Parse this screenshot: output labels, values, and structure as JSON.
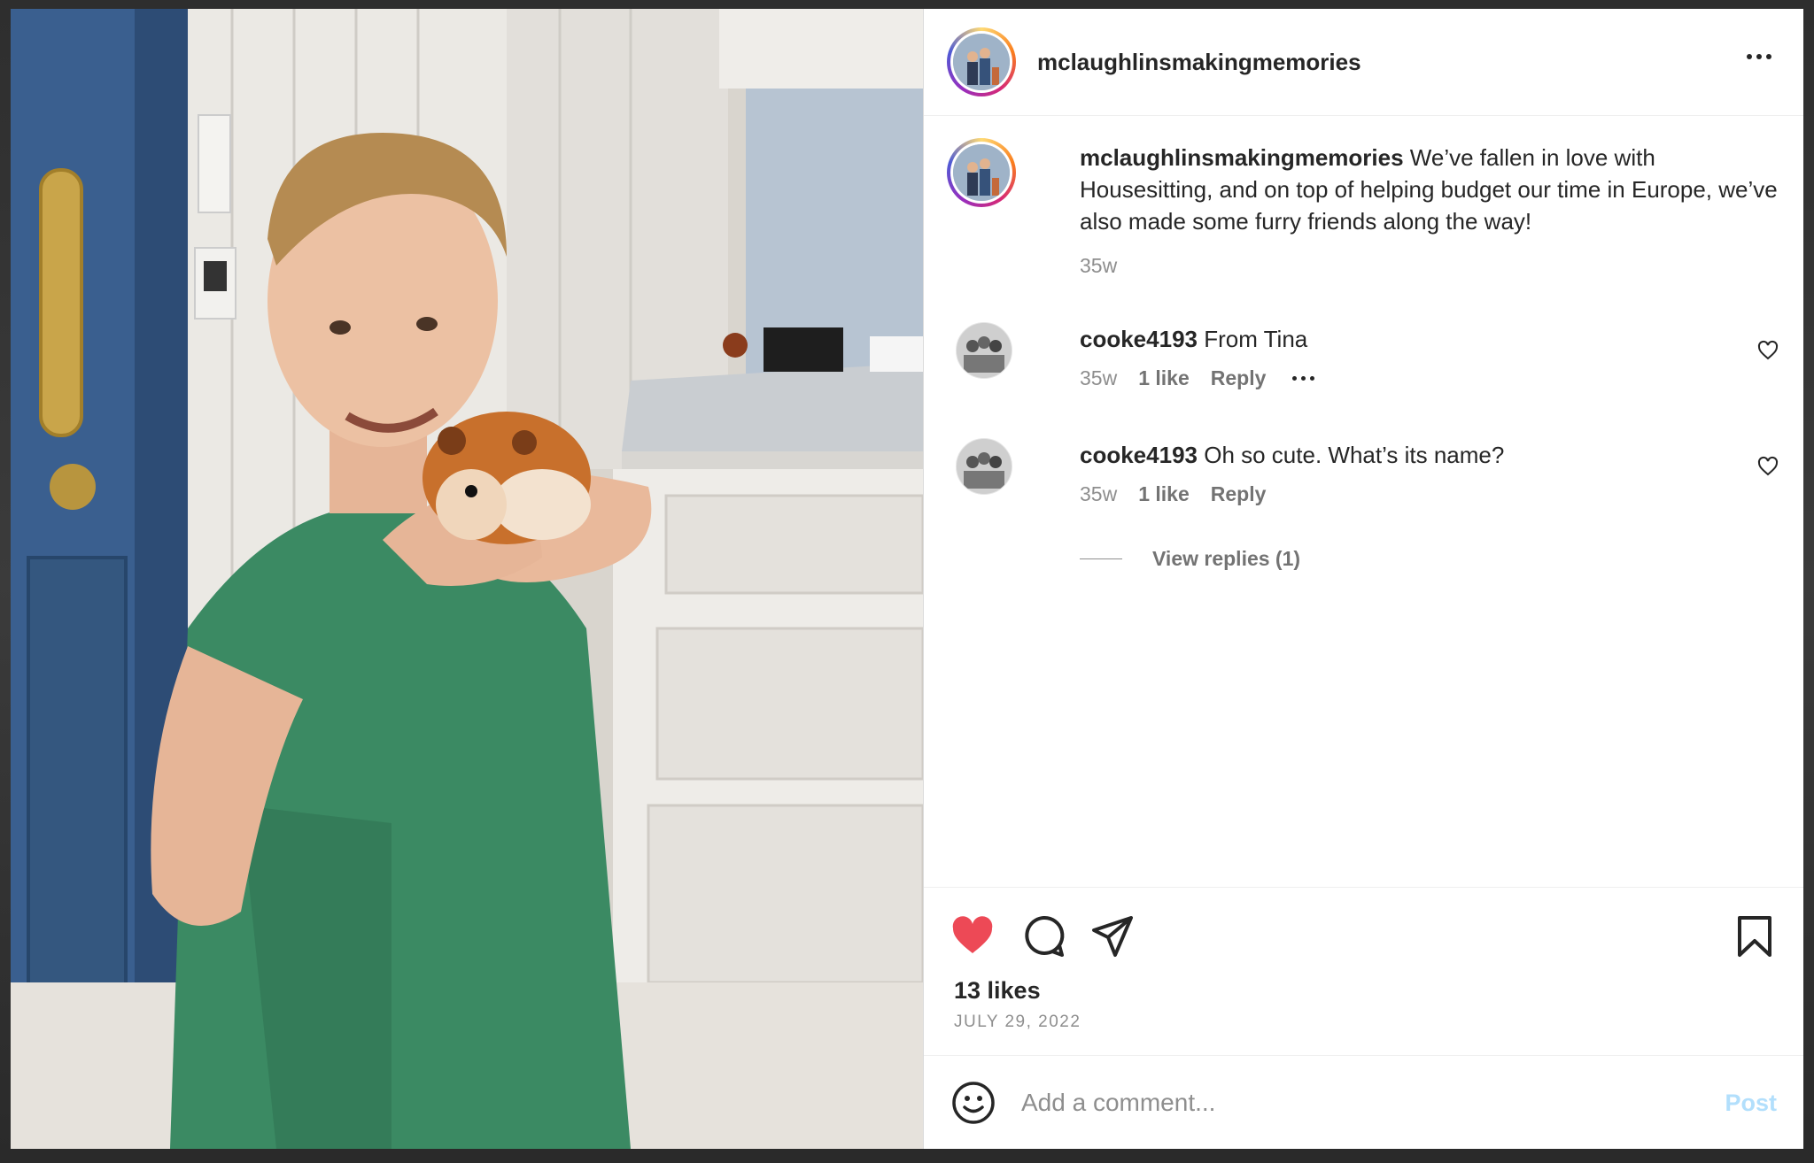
{
  "post": {
    "username": "mclaughlinsmakingmemories",
    "caption": "We’ve fallen in love with Housesitting, and on top of helping budget our time in Europe, we’ve also made some furry friends along the way!",
    "caption_age": "35w",
    "likes": "13 likes",
    "date": "JULY 29, 2022",
    "liked": true
  },
  "comments": [
    {
      "username": "cooke4193",
      "text": "From Tina",
      "age": "35w",
      "likes": "1 like",
      "reply_label": "Reply",
      "show_more": true
    },
    {
      "username": "cooke4193",
      "text": "Oh so cute. What’s its name?",
      "age": "35w",
      "likes": "1 like",
      "reply_label": "Reply",
      "show_more": false
    }
  ],
  "view_replies": "View replies (1)",
  "comment_box": {
    "placeholder": "Add a comment...",
    "post_label": "Post"
  },
  "colors": {
    "like_red": "#ed4956",
    "post_blue_disabled": "#b2dffc",
    "text": "#262626",
    "secondary": "#8e8e8e"
  },
  "icons": [
    "more-options-icon",
    "heart-icon",
    "comment-icon",
    "share-icon",
    "bookmark-icon",
    "emoji-icon"
  ]
}
